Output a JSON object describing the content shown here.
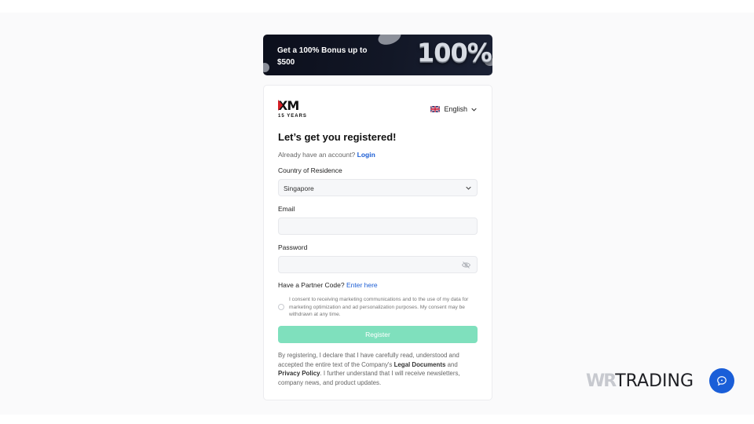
{
  "banner": {
    "text": "Get a 100% Bonus up to $500",
    "big": "100%"
  },
  "logo": {
    "mark": "XM",
    "years": "15 YEARS"
  },
  "language": {
    "label": "English"
  },
  "form": {
    "title": "Let’s get you registered!",
    "already_text": "Already have an account?",
    "login_link": "Login",
    "country_label": "Country of Residence",
    "country_value": "Singapore",
    "email_label": "Email",
    "email_value": "",
    "password_label": "Password",
    "password_value": "",
    "partner_text": "Have a Partner Code?",
    "partner_link": "Enter here",
    "consent": "I consent to receiving marketing communications and to the use of my data for marketing optimization and ad personalization purposes. My consent may be withdrawn at any time.",
    "register_label": "Register",
    "legal_1": "By registering, I declare that I have carefully read, understood and accepted the entire text of the Company's",
    "legal_link_1": "Legal Documents",
    "legal_2": "and",
    "legal_link_2": "Privacy Policy",
    "legal_3": ". I further understand that I will receive newsletters, company news, and product updates."
  },
  "watermark": {
    "wr": "WR",
    "trading": "TRADING"
  },
  "colors": {
    "accent": "#1b5dd4",
    "register_button": "#7fe0bd",
    "brand_red": "#d51f26"
  },
  "icons": {
    "language": "uk-flag-icon",
    "dropdown": "chevron-down-icon",
    "password": "eye-off-icon",
    "chat": "chat-bubble-icon"
  }
}
